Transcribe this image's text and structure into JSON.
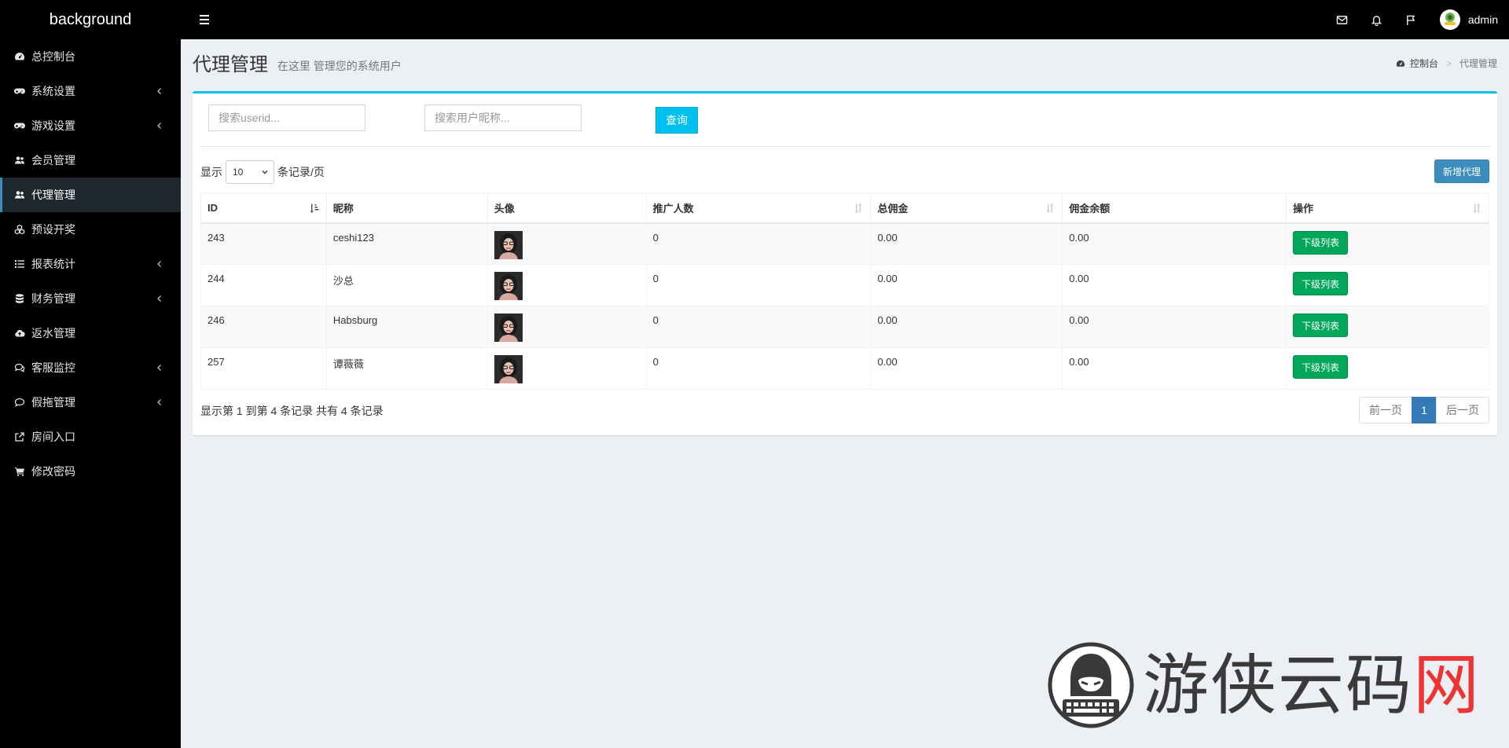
{
  "topbar": {
    "brand": "background",
    "user_name": "admin"
  },
  "sidebar": {
    "items": [
      {
        "label": "总控制台",
        "icon": "dashboard-icon",
        "has_children": false,
        "active": false
      },
      {
        "label": "系统设置",
        "icon": "gamepad-icon",
        "has_children": true,
        "active": false
      },
      {
        "label": "游戏设置",
        "icon": "gamepad-icon",
        "has_children": true,
        "active": false
      },
      {
        "label": "会员管理",
        "icon": "users-icon",
        "has_children": false,
        "active": false
      },
      {
        "label": "代理管理",
        "icon": "users-icon",
        "has_children": false,
        "active": true
      },
      {
        "label": "预设开奖",
        "icon": "cubes-icon",
        "has_children": false,
        "active": false
      },
      {
        "label": "报表统计",
        "icon": "list-icon",
        "has_children": true,
        "active": false
      },
      {
        "label": "财务管理",
        "icon": "database-icon",
        "has_children": true,
        "active": false
      },
      {
        "label": "返水管理",
        "icon": "cloud-upload-icon",
        "has_children": false,
        "active": false
      },
      {
        "label": "客服监控",
        "icon": "comments-icon",
        "has_children": true,
        "active": false
      },
      {
        "label": "假拖管理",
        "icon": "comment-icon",
        "has_children": true,
        "active": false
      },
      {
        "label": "房间入口",
        "icon": "external-link-icon",
        "has_children": false,
        "active": false
      },
      {
        "label": "修改密码",
        "icon": "cart-icon",
        "has_children": false,
        "active": false
      }
    ]
  },
  "header": {
    "title": "代理管理",
    "subtitle": "在这里 管理您的系统用户",
    "breadcrumb_home": "控制台",
    "breadcrumb_current": "代理管理"
  },
  "search": {
    "userid_placeholder": "搜索userid...",
    "nickname_placeholder": "搜索用户昵称...",
    "query_label": "查询"
  },
  "length": {
    "prefix": "显示",
    "value": "10",
    "suffix": "条记录/页"
  },
  "add_label": "新增代理",
  "table": {
    "columns": [
      "ID",
      "昵称",
      "头像",
      "推广人数",
      "总佣金",
      "佣金余额",
      "操作"
    ],
    "action_label": "下级列表",
    "rows": [
      {
        "id": "243",
        "nickname": "ceshi123",
        "promoted": "0",
        "total": "0.00",
        "balance": "0.00"
      },
      {
        "id": "244",
        "nickname": "沙总",
        "promoted": "0",
        "total": "0.00",
        "balance": "0.00"
      },
      {
        "id": "246",
        "nickname": "Habsburg",
        "promoted": "0",
        "total": "0.00",
        "balance": "0.00"
      },
      {
        "id": "257",
        "nickname": "谭薇薇",
        "promoted": "0",
        "total": "0.00",
        "balance": "0.00"
      }
    ]
  },
  "info": "显示第 1 到第 4 条记录 共有 4 条记录",
  "pagination": {
    "prev": "前一页",
    "current": "1",
    "next": "后一页"
  },
  "watermark": {
    "text_main": "游侠云码",
    "text_red": "网"
  },
  "colors": {
    "accent": "#00c0ef",
    "primary": "#3c8dbc",
    "success": "#00a65a"
  }
}
